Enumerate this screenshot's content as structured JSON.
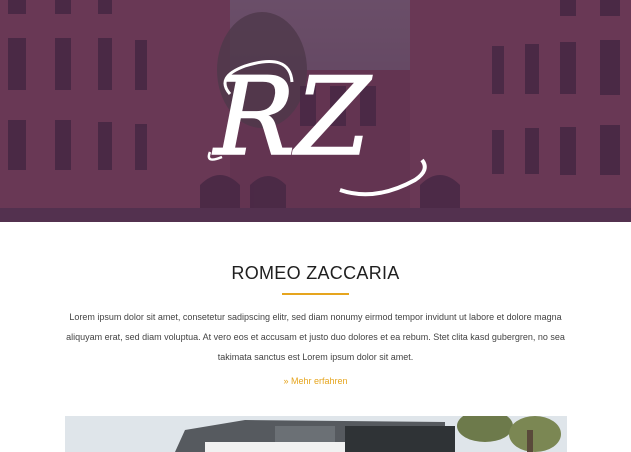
{
  "hero": {
    "monogram_text": "RZ",
    "tint_color": "#4e2a4e"
  },
  "intro": {
    "title": "ROMEO ZACCARIA",
    "paragraph": "Lorem ipsum dolor sit amet, consetetur sadipscing elitr, sed diam nonumy eirmod tempor invidunt ut labore et dolore magna aliquyam erat, sed diam voluptua. At vero eos et accusam et justo duo dolores et ea rebum. Stet clita kasd gubergren, no sea takimata sanctus est Lorem ipsum dolor sit amet.",
    "more_link": "» Mehr erfahren",
    "accent_color": "#e6a51e"
  }
}
